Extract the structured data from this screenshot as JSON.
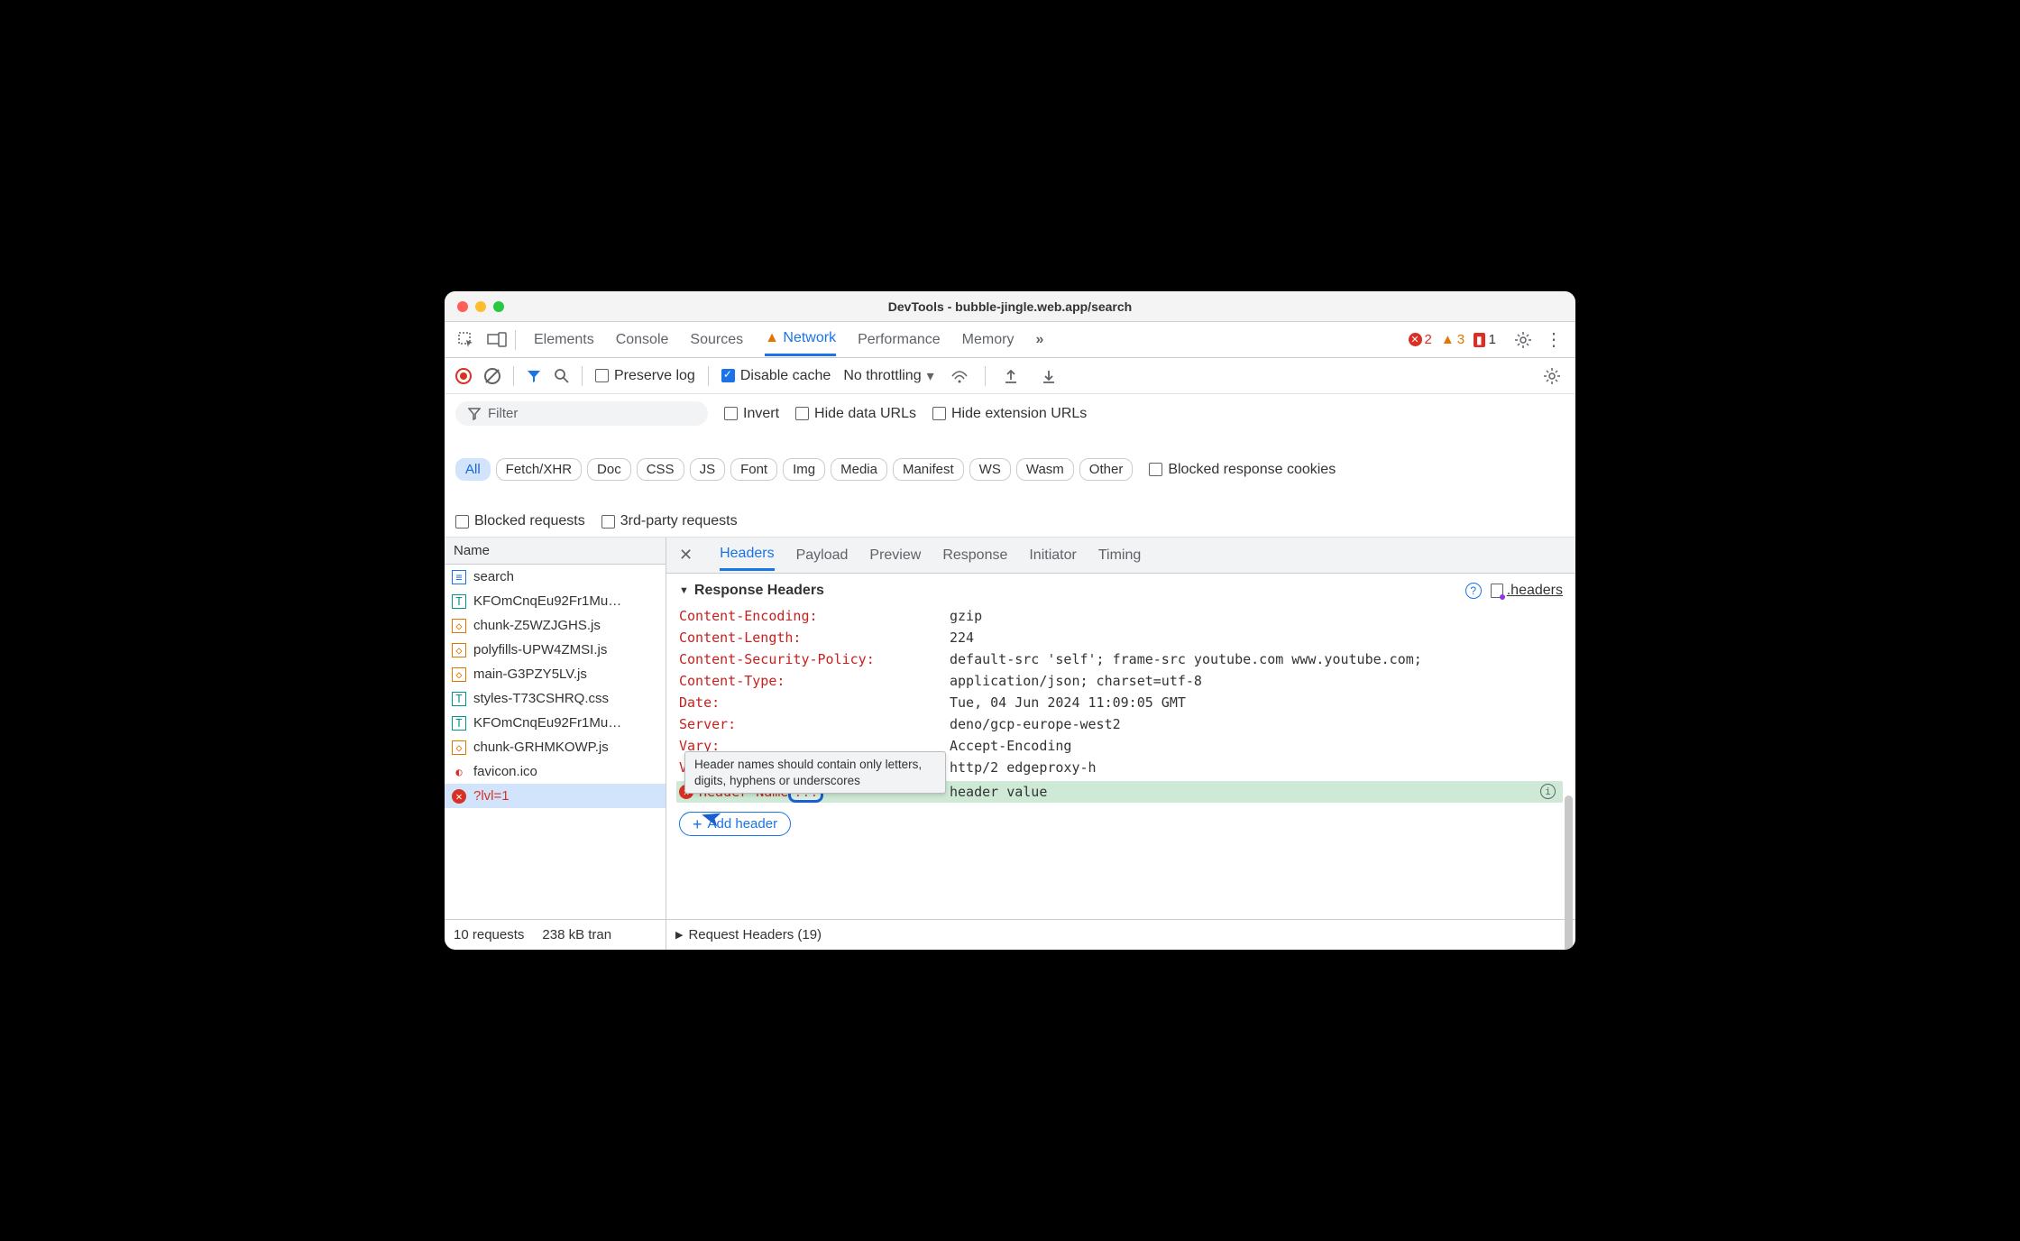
{
  "window": {
    "title": "DevTools - bubble-jingle.web.app/search"
  },
  "tabs": {
    "elements": "Elements",
    "console": "Console",
    "sources": "Sources",
    "network": "Network",
    "performance": "Performance",
    "memory": "Memory"
  },
  "badges": {
    "errors": "2",
    "warnings": "3",
    "issues": "1"
  },
  "toolbar": {
    "preserve_log": "Preserve log",
    "disable_cache": "Disable cache",
    "throttling": "No throttling"
  },
  "filterRow": {
    "filter_placeholder": "Filter",
    "invert": "Invert",
    "hide_data_urls": "Hide data URLs",
    "hide_ext_urls": "Hide extension URLs",
    "blocked_cookies": "Blocked response cookies",
    "blocked_requests": "Blocked requests",
    "third_party": "3rd-party requests"
  },
  "chips": {
    "all": "All",
    "fetch": "Fetch/XHR",
    "doc": "Doc",
    "css": "CSS",
    "js": "JS",
    "font": "Font",
    "img": "Img",
    "media": "Media",
    "manifest": "Manifest",
    "ws": "WS",
    "wasm": "Wasm",
    "other": "Other"
  },
  "leftPane": {
    "col_name": "Name",
    "requests": [
      {
        "name": "search",
        "type": "doc"
      },
      {
        "name": "KFOmCnqEu92Fr1Mu…",
        "type": "font"
      },
      {
        "name": "chunk-Z5WZJGHS.js",
        "type": "js"
      },
      {
        "name": "polyfills-UPW4ZMSI.js",
        "type": "js"
      },
      {
        "name": "main-G3PZY5LV.js",
        "type": "js"
      },
      {
        "name": "styles-T73CSHRQ.css",
        "type": "font"
      },
      {
        "name": "KFOmCnqEu92Fr1Mu…",
        "type": "font"
      },
      {
        "name": "chunk-GRHMKOWP.js",
        "type": "js"
      },
      {
        "name": "favicon.ico",
        "type": "ico"
      },
      {
        "name": "?lvl=1",
        "type": "errx",
        "error": true,
        "selected": true
      }
    ]
  },
  "detailTabs": {
    "headers": "Headers",
    "payload": "Payload",
    "preview": "Preview",
    "response": "Response",
    "initiator": "Initiator",
    "timing": "Timing"
  },
  "responseHeaders": {
    "section_title": "Response Headers",
    "headers_file": ".headers",
    "rows": [
      {
        "name": "Content-Encoding:",
        "value": "gzip"
      },
      {
        "name": "Content-Length:",
        "value": "224"
      },
      {
        "name": "Content-Security-Policy:",
        "value": "default-src 'self'; frame-src youtube.com www.youtube.com;"
      },
      {
        "name": "Content-Type:",
        "value": "application/json; charset=utf-8"
      },
      {
        "name": "Date:",
        "value": "Tue, 04 Jun 2024 11:09:05 GMT"
      },
      {
        "name": "Server:",
        "value": "deno/gcp-europe-west2"
      },
      {
        "name": "Vary:",
        "value": "Accept-Encoding"
      },
      {
        "name": "Via:",
        "value": "http/2 edgeproxy-h"
      }
    ],
    "editable": {
      "name_prefix": "Header-Name",
      "name_marked": "!!!",
      "value": "header value"
    },
    "add_header": "Add header",
    "tooltip": "Header names should contain only letters, digits, hyphens or underscores"
  },
  "requestHeaders": {
    "title": "Request Headers (19)"
  },
  "status": {
    "requests": "10 requests",
    "transferred": "238 kB tran"
  }
}
